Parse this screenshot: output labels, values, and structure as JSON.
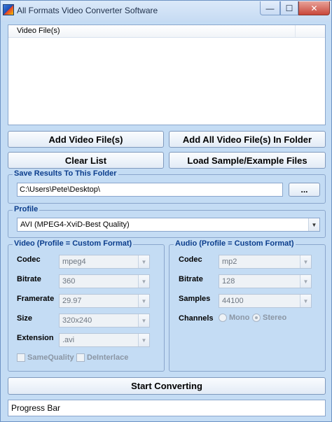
{
  "window": {
    "title": "All Formats Video Converter Software",
    "minimize": "—",
    "maximize": "☐",
    "close": "✕"
  },
  "file_list": {
    "column_header": "Video File(s)"
  },
  "buttons": {
    "add_files": "Add Video File(s)",
    "add_folder": "Add All Video File(s) In Folder",
    "clear_list": "Clear List",
    "load_samples": "Load Sample/Example Files",
    "browse": "...",
    "start": "Start Converting"
  },
  "save_folder": {
    "label": "Save Results To This Folder",
    "path": "C:\\Users\\Pete\\Desktop\\"
  },
  "profile": {
    "label": "Profile",
    "selected": "AVI (MPEG4-XviD-Best Quality)"
  },
  "video": {
    "label": "Video (Profile = Custom Format)",
    "codec_label": "Codec",
    "codec": "mpeg4",
    "bitrate_label": "Bitrate",
    "bitrate": "360",
    "framerate_label": "Framerate",
    "framerate": "29.97",
    "size_label": "Size",
    "size": "320x240",
    "extension_label": "Extension",
    "extension": ".avi",
    "same_quality": "SameQuality",
    "deinterlace": "DeInterlace"
  },
  "audio": {
    "label": "Audio (Profile = Custom Format)",
    "codec_label": "Codec",
    "codec": "mp2",
    "bitrate_label": "Bitrate",
    "bitrate": "128",
    "samples_label": "Samples",
    "samples": "44100",
    "channels_label": "Channels",
    "mono": "Mono",
    "stereo": "Stereo"
  },
  "progress": {
    "text": "Progress Bar"
  }
}
